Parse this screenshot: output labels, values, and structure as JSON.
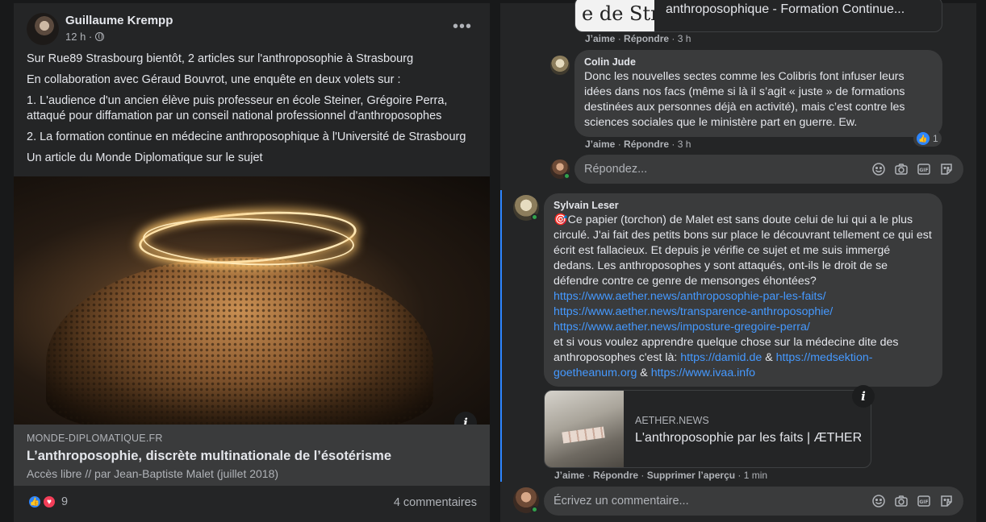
{
  "post": {
    "author": "Guillaume Krempp",
    "time": "12 h ·",
    "paragraphs": [
      "Sur Rue89 Strasbourg bientôt, 2 articles sur l'anthroposophie à Strasbourg",
      "En collaboration avec Géraud Bouvrot, une enquête en deux volets sur :",
      "1. L'audience d'un ancien élève puis professeur en école Steiner, Grégoire Perra, attaqué pour diffamation par un conseil national professionnel d'anthroposophes",
      "2. La formation continue en médecine anthroposophique à l'Université de Strasbourg",
      "Un article du Monde Diplomatique sur le sujet"
    ],
    "link": {
      "domain": "MONDE-DIPLOMATIQUE.FR",
      "title": "L’anthroposophie, discrète multinationale de l’ésotérisme",
      "description": "Accès libre // par Jean-Baptiste Malet (juillet 2018)"
    },
    "reaction_count": "9",
    "comments_label": "4 commentaires"
  },
  "comments": {
    "top_card": {
      "thumb_text": "e de Str",
      "title": "anthroposophique - Formation Continue..."
    },
    "actions_1": {
      "like": "J’aime",
      "reply": "Répondre",
      "time": "3 h"
    },
    "colin": {
      "name": "Colin Jude",
      "body": "Donc les nouvelles sectes comme les Colibris font infuser leurs idées dans nos facs (même si là il s’agit « juste » de formations destinées aux personnes déjà en activité), mais c’est contre les sciences sociales que le ministère part en guerre. Ew.",
      "likes": "1"
    },
    "actions_2": {
      "like": "J’aime",
      "reply": "Répondre",
      "time": "3 h"
    },
    "reply_placeholder": "Répondez...",
    "sylvain": {
      "name": "Sylvain Leser",
      "intro": "🎯Ce papier (torchon) de Malet est sans doute celui de lui qui a le plus circulé. J'ai fait des petits bons sur place le découvrant tellement ce qui est écrit est fallacieux. Et depuis je vérifie ce sujet et me suis immergé dedans. Les anthroposophes y sont attaqués, ont-ils le droit de se défendre contre ce genre de mensonges éhontées?",
      "link1": "https://www.aether.news/anthroposophie-par-les-faits/",
      "link2": "https://www.aether.news/transparence-anthroposophie/",
      "link3": "https://www.aether.news/imposture-gregoire-perra/",
      "outro_pre": "et si vous voulez apprendre quelque chose sur la médecine dite des anthroposophes c'est là: ",
      "link4": "https://damid.de",
      "amp1": " & ",
      "link5": "https://medsektion-goetheanum.org",
      "amp2": " & ",
      "link6": "https://www.ivaa.info"
    },
    "preview": {
      "domain": "AETHER.NEWS",
      "title": "L'anthroposophie par les faits | ÆTHER"
    },
    "actions_3": {
      "like": "J’aime",
      "reply": "Répondre",
      "delete_preview": "Supprimer l’aperçu",
      "time": "1 min"
    },
    "write_placeholder": "Écrivez un commentaire..."
  },
  "icons": {
    "globe": "globe-icon",
    "more": "more-icon",
    "info": "info-icon",
    "like": "like-icon",
    "love": "love-icon",
    "emoji": "emoji-icon",
    "camera": "camera-icon",
    "gif": "gif-icon",
    "sticker": "sticker-icon"
  },
  "colors": {
    "background": "#18191a",
    "card": "#242526",
    "bubble": "#3a3b3c",
    "link": "#4599ff",
    "like_blue": "#2d86ff",
    "love_red": "#f33e58",
    "online_green": "#31a24c"
  }
}
